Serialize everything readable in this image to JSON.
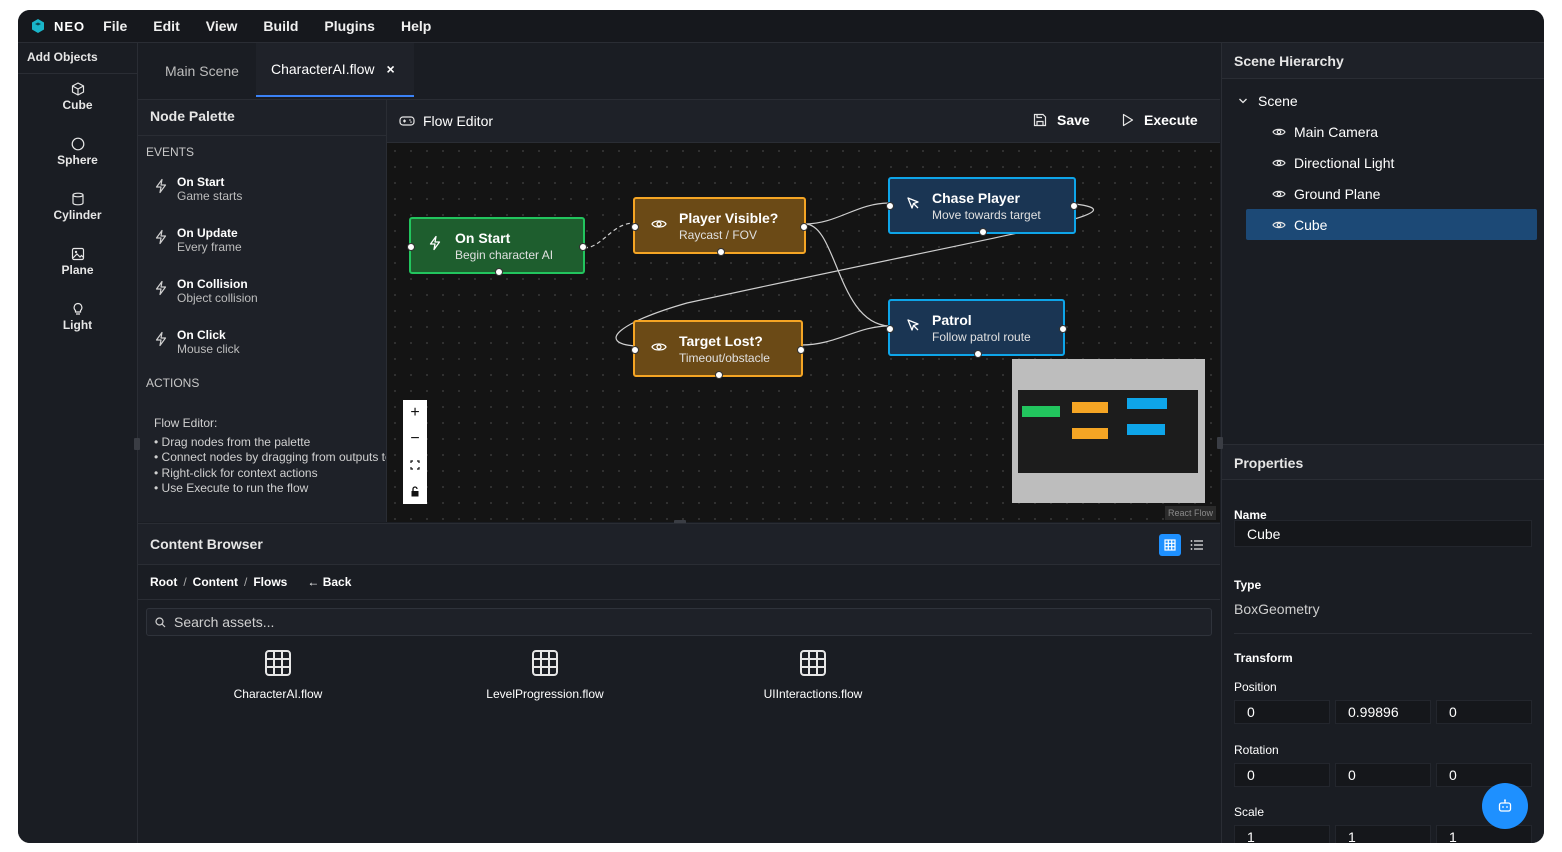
{
  "app": {
    "logo_text": "NEO",
    "accent": "#3b82f6"
  },
  "menu": [
    "File",
    "Edit",
    "View",
    "Build",
    "Plugins",
    "Help"
  ],
  "add_objects": {
    "title": "Add Objects",
    "items": [
      {
        "label": "Cube",
        "icon": "cube-icon"
      },
      {
        "label": "Sphere",
        "icon": "circle-icon"
      },
      {
        "label": "Cylinder",
        "icon": "cylinder-icon"
      },
      {
        "label": "Plane",
        "icon": "image-icon"
      },
      {
        "label": "Light",
        "icon": "lightbulb-icon"
      }
    ]
  },
  "tabs": [
    {
      "label": "Main Scene",
      "active": false
    },
    {
      "label": "CharacterAI.flow",
      "active": true,
      "close": "×"
    }
  ],
  "palette": {
    "title": "Node Palette",
    "events_label": "EVENTS",
    "events": [
      {
        "name": "On Start",
        "desc": "Game starts"
      },
      {
        "name": "On Update",
        "desc": "Every frame"
      },
      {
        "name": "On Collision",
        "desc": "Object collision"
      },
      {
        "name": "On Click",
        "desc": "Mouse click"
      }
    ],
    "actions_label": "ACTIONS",
    "help": {
      "title": "Flow Editor:",
      "lines": [
        "• Drag nodes from the palette",
        "• Connect nodes by dragging from outputs to inputs",
        "• Right-click for context actions",
        "• Use Execute to run the flow"
      ]
    }
  },
  "editor": {
    "title": "Flow Editor",
    "save_label": "Save",
    "execute_label": "Execute",
    "attribution": "React Flow",
    "nodes": [
      {
        "title": "On Start",
        "subtitle": "Begin character AI",
        "kind": "event",
        "color": "#22c55e"
      },
      {
        "title": "Player Visible?",
        "subtitle": "Raycast / FOV",
        "kind": "condition",
        "color": "#f5a524"
      },
      {
        "title": "Chase Player",
        "subtitle": "Move towards target",
        "kind": "action",
        "color": "#0ea5e9"
      },
      {
        "title": "Target Lost?",
        "subtitle": "Timeout/obstacle",
        "kind": "condition",
        "color": "#f5a524"
      },
      {
        "title": "Patrol",
        "subtitle": "Follow patrol route",
        "kind": "action",
        "color": "#0ea5e9"
      }
    ],
    "zoom_controls": [
      "+",
      "−"
    ]
  },
  "content_browser": {
    "title": "Content Browser",
    "breadcrumb": [
      "Root",
      "Content",
      "Flows"
    ],
    "back_label": "← Back",
    "search_placeholder": "Search assets...",
    "files": [
      "CharacterAI.flow",
      "LevelProgression.flow",
      "UIInteractions.flow"
    ]
  },
  "hierarchy": {
    "title": "Scene Hierarchy",
    "root": "Scene",
    "items": [
      "Main Camera",
      "Directional Light",
      "Ground Plane",
      "Cube"
    ],
    "selected": "Cube"
  },
  "properties": {
    "title": "Properties",
    "name_label": "Name",
    "name_value": "Cube",
    "type_label": "Type",
    "type_value": "BoxGeometry",
    "transform_label": "Transform",
    "position_label": "Position",
    "position": [
      "0",
      "0.99896",
      "0"
    ],
    "rotation_label": "Rotation",
    "rotation": [
      "0",
      "0",
      "0"
    ],
    "scale_label": "Scale",
    "scale": [
      "1",
      "1",
      "1"
    ]
  }
}
